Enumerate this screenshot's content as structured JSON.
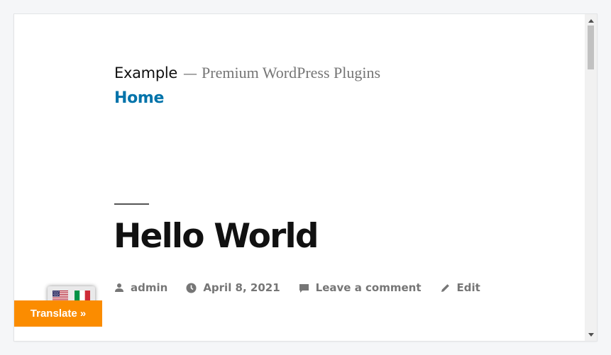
{
  "site": {
    "title": "Example",
    "separator": "—",
    "tagline": "Premium WordPress Plugins"
  },
  "nav": {
    "home_label": "Home"
  },
  "post": {
    "title": "Hello World",
    "author": "admin",
    "date": "April 8, 2021",
    "comment_link": "Leave a comment",
    "edit_link": "Edit"
  },
  "translator": {
    "button_label": "Translate »",
    "languages": [
      {
        "code": "en",
        "icon": "us-flag-icon"
      },
      {
        "code": "it",
        "icon": "italy-flag-icon"
      }
    ]
  },
  "colors": {
    "link": "#0073aa",
    "translate_button": "#fb8c00",
    "meta_text": "#767676"
  }
}
